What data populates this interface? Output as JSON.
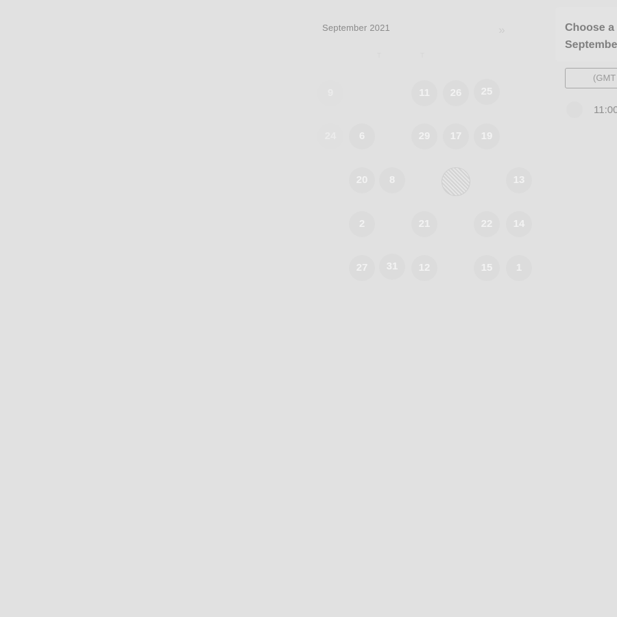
{
  "calendar": {
    "month_title": "September 2021",
    "next_arrow": "»",
    "weekday_labels": [
      "T",
      "T"
    ],
    "days": [
      {
        "label": "9",
        "state": "normal"
      },
      {
        "label": "11",
        "state": "normal"
      },
      {
        "label": "26",
        "state": "normal"
      },
      {
        "label": "25",
        "state": "normal"
      },
      {
        "label": "24",
        "state": "normal"
      },
      {
        "label": "6",
        "state": "normal"
      },
      {
        "label": "29",
        "state": "normal"
      },
      {
        "label": "17",
        "state": "normal"
      },
      {
        "label": "19",
        "state": "normal"
      },
      {
        "label": "20",
        "state": "normal"
      },
      {
        "label": "8",
        "state": "normal"
      },
      {
        "label": "",
        "state": "selected"
      },
      {
        "label": "13",
        "state": "normal"
      },
      {
        "label": "2",
        "state": "normal"
      },
      {
        "label": "21",
        "state": "normal"
      },
      {
        "label": "22",
        "state": "normal"
      },
      {
        "label": "14",
        "state": "normal"
      },
      {
        "label": "27",
        "state": "normal"
      },
      {
        "label": "31",
        "state": "normal"
      },
      {
        "label": "12",
        "state": "normal"
      },
      {
        "label": "15",
        "state": "normal"
      },
      {
        "label": "1",
        "state": "normal"
      }
    ]
  },
  "side_panel": {
    "title_line1": "Choose a",
    "title_line2": "Septembe",
    "timezone_select": "(GMT",
    "time_slot": "11:00"
  }
}
